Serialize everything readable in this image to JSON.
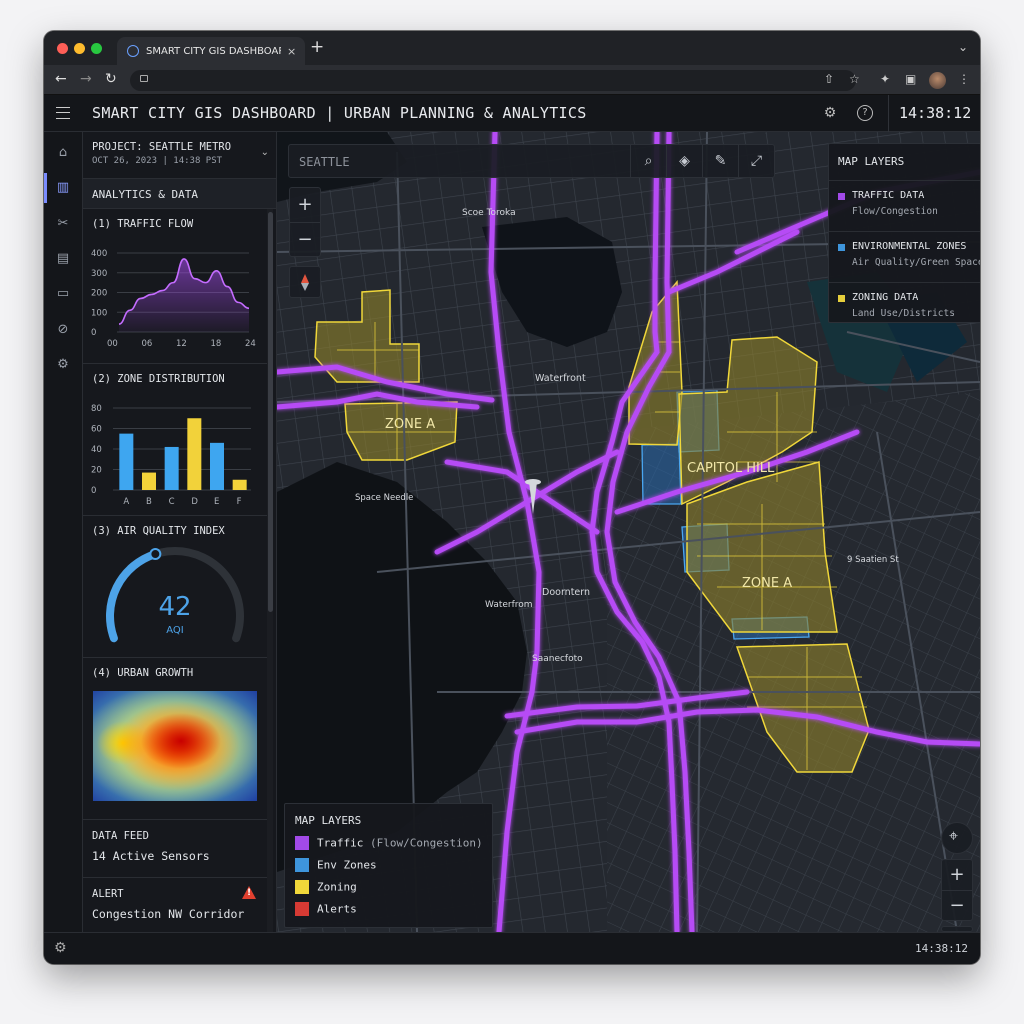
{
  "browser": {
    "tab_title": "SMART CITY GIS DASHBOARD",
    "tab_close": "×",
    "new_tab": "+"
  },
  "header": {
    "title": "SMART CITY GIS DASHBOARD | URBAN PLANNING & ANALYTICS",
    "clock": "14:38:12"
  },
  "project": {
    "name": "PROJECT: SEATTLE METRO",
    "date": "OCT 26, 2023 | 14:38 PST"
  },
  "panel": {
    "section_title": "ANALYTICS & DATA",
    "traffic_flow": {
      "title": "(1) TRAFFIC FLOW",
      "y_ticks": [
        "400",
        "300",
        "200",
        "100",
        "0"
      ],
      "x_ticks": [
        "00",
        "06",
        "12",
        "18",
        "24"
      ]
    },
    "zone_distribution": {
      "title": "(2) ZONE DISTRIBUTION",
      "y_ticks": [
        "80",
        "60",
        "40",
        "20",
        "0"
      ]
    },
    "air_quality": {
      "title": "(3) AIR QUALITY INDEX",
      "value": "42",
      "unit": "AQI"
    },
    "urban_growth": {
      "title": "(4) URBAN GROWTH"
    },
    "data_feed": {
      "label": "DATA FEED",
      "value": "14 Active Sensors"
    },
    "alert": {
      "label": "ALERT",
      "value": "Congestion NW Corridor"
    }
  },
  "chart_data": [
    {
      "type": "area",
      "title": "(1) TRAFFIC FLOW",
      "x": [
        0,
        2,
        4,
        6,
        8,
        10,
        12,
        14,
        16,
        18,
        20,
        22,
        24
      ],
      "values": [
        40,
        110,
        170,
        190,
        210,
        250,
        370,
        270,
        250,
        310,
        230,
        150,
        120
      ],
      "xlim": [
        0,
        24
      ],
      "ylim": [
        0,
        400
      ],
      "color": "#a24ae8"
    },
    {
      "type": "bar",
      "title": "(2) ZONE DISTRIBUTION",
      "categories": [
        "A",
        "B",
        "C",
        "D",
        "E",
        "F"
      ],
      "values": [
        55,
        17,
        42,
        70,
        46,
        10
      ],
      "colors": [
        "#3ea6f0",
        "#f2d23a",
        "#3ea6f0",
        "#f2d23a",
        "#3ea6f0",
        "#f2d23a"
      ],
      "ylim": [
        0,
        80
      ]
    },
    {
      "type": "gauge",
      "title": "(3) AIR QUALITY INDEX",
      "value": 42,
      "color": "#4da3e8"
    }
  ],
  "map": {
    "search_placeholder": "SEATTLE",
    "zone_labels": [
      "ZONE A",
      "CAPITOL HILL",
      "ZONE A"
    ],
    "place_labels": [
      "Waterfront",
      "Space Needle",
      "Waterfrom",
      "Doorntern",
      "Saanecfoto",
      "9 Saatien St"
    ],
    "layers_panel": {
      "title": "MAP LAYERS",
      "items": [
        {
          "name": "TRAFFIC DATA",
          "sub": "Flow/Congestion",
          "color": "#a24ae8"
        },
        {
          "name": "ENVIRONMENTAL ZONES",
          "sub": "Air Quality/Green Spaces",
          "color": "#3e95dc"
        },
        {
          "name": "ZONING DATA",
          "sub": "Land Use/Districts",
          "color": "#e6cf3c"
        }
      ]
    },
    "legend": {
      "title": "MAP LAYERS",
      "items": [
        {
          "label": "Traffic",
          "sub": "(Flow/Congestion)",
          "color": "#a24ae8"
        },
        {
          "label": "Env Zones",
          "sub": "",
          "color": "#3e95dc"
        },
        {
          "label": "Zoning",
          "sub": "",
          "color": "#f0d73a"
        },
        {
          "label": "Alerts",
          "sub": "",
          "color": "#d63a34"
        }
      ]
    }
  },
  "status": {
    "time": "14:38:12"
  },
  "colors": {
    "accent": "#a24ae8",
    "env": "#3e95dc",
    "zoning": "#e6cf3c",
    "alert": "#d63a34"
  }
}
